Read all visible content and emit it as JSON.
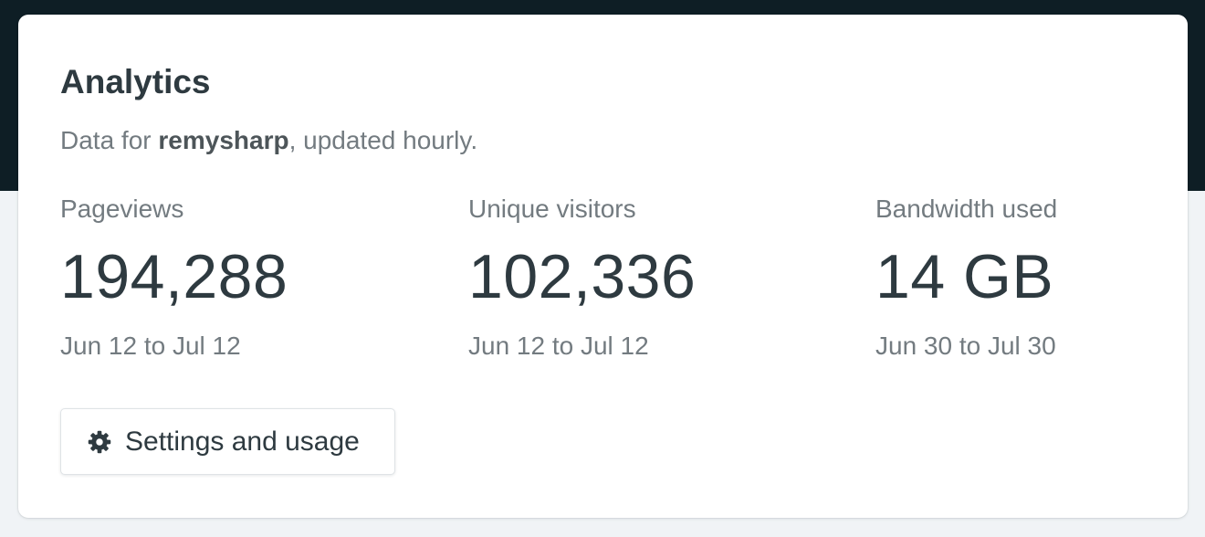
{
  "card": {
    "title": "Analytics",
    "subtitle_prefix": "Data for ",
    "site_name": "remysharp",
    "subtitle_suffix": ", updated hourly."
  },
  "stats": [
    {
      "label": "Pageviews",
      "value": "194,288",
      "range": "Jun 12 to Jul 12"
    },
    {
      "label": "Unique visitors",
      "value": "102,336",
      "range": "Jun 12 to Jul 12"
    },
    {
      "label": "Bandwidth used",
      "value": "14 GB",
      "range": "Jun 30 to Jul 30"
    }
  ],
  "settings_button": {
    "label": "Settings and usage",
    "icon": "gear-icon"
  },
  "colors": {
    "header_band": "#0e1e25",
    "page_background": "#f0f3f6",
    "card_background": "#ffffff",
    "text_primary": "#2e3a40",
    "text_secondary": "#737b80"
  }
}
